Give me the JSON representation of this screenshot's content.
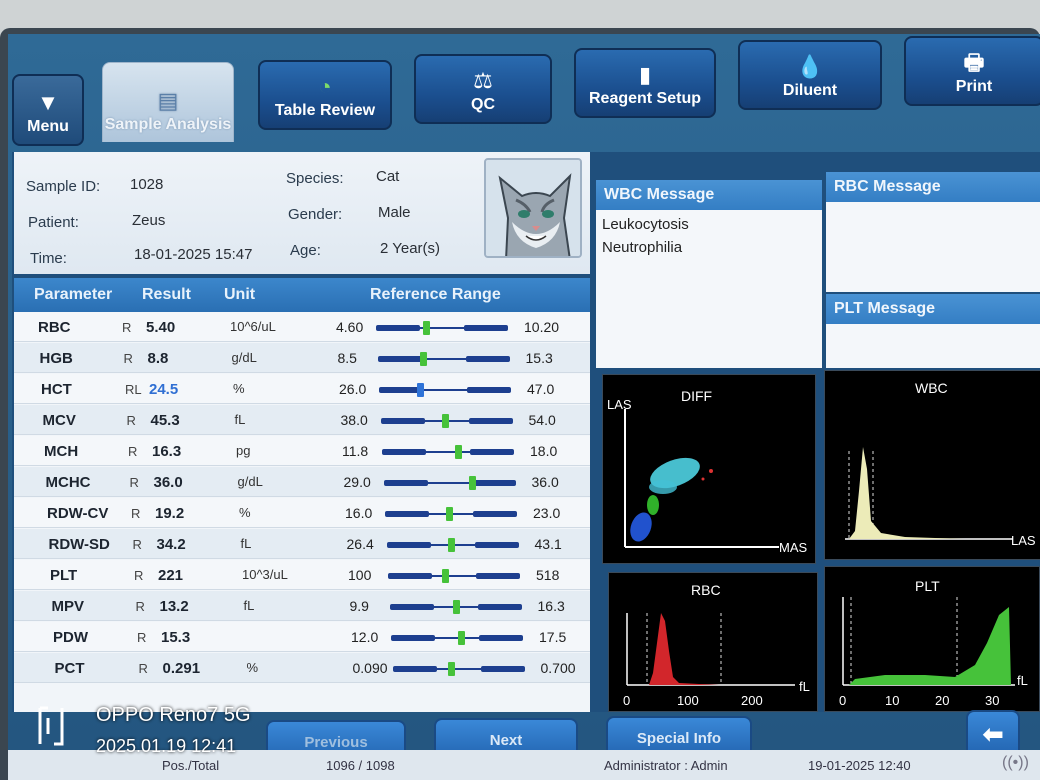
{
  "toolbar": {
    "menu": "Menu",
    "sample_analysis": "Sample Analysis",
    "table_review": "Table Review",
    "qc": "QC",
    "reagent_setup": "Reagent Setup",
    "diluent": "Diluent",
    "print": "Print"
  },
  "sample": {
    "sample_id_label": "Sample ID:",
    "sample_id": "1028",
    "patient_label": "Patient:",
    "patient": "Zeus",
    "time_label": "Time:",
    "time": "18-01-2025 15:47",
    "species_label": "Species:",
    "species": "Cat",
    "gender_label": "Gender:",
    "gender": "Male",
    "age_label": "Age:",
    "age": "2 Year(s)"
  },
  "table": {
    "headers": {
      "parameter": "Parameter",
      "result": "Result",
      "unit": "Unit",
      "reference": "Reference Range"
    },
    "rows": [
      {
        "name": "RBC",
        "flag": "R",
        "result": "5.40",
        "unit": "10^6/uL",
        "lo": "4.60",
        "hi": "10.20",
        "pos": 0.14
      },
      {
        "name": "HGB",
        "flag": "R",
        "result": "8.8",
        "unit": "g/dL",
        "lo": "8.5",
        "hi": "15.3",
        "pos": 0.04
      },
      {
        "name": "HCT",
        "flag": "RL",
        "result": "24.5",
        "unit": "%",
        "lo": "26.0",
        "hi": "47.0",
        "pos": -0.07
      },
      {
        "name": "MCV",
        "flag": "R",
        "result": "45.3",
        "unit": "fL",
        "lo": "38.0",
        "hi": "54.0",
        "pos": 0.46
      },
      {
        "name": "MCH",
        "flag": "R",
        "result": "16.3",
        "unit": "pg",
        "lo": "11.8",
        "hi": "18.0",
        "pos": 0.73
      },
      {
        "name": "MCHC",
        "flag": "R",
        "result": "36.0",
        "unit": "g/dL",
        "lo": "29.0",
        "hi": "36.0",
        "pos": 1.0
      },
      {
        "name": "RDW-CV",
        "flag": "R",
        "result": "19.2",
        "unit": "%",
        "lo": "16.0",
        "hi": "23.0",
        "pos": 0.46
      },
      {
        "name": "RDW-SD",
        "flag": "R",
        "result": "34.2",
        "unit": "fL",
        "lo": "26.4",
        "hi": "43.1",
        "pos": 0.47
      },
      {
        "name": "PLT",
        "flag": "R",
        "result": "221",
        "unit": "10^3/uL",
        "lo": "100",
        "hi": "518",
        "pos": 0.29
      },
      {
        "name": "MPV",
        "flag": "R",
        "result": "13.2",
        "unit": "fL",
        "lo": "9.9",
        "hi": "16.3",
        "pos": 0.52
      },
      {
        "name": "PDW",
        "flag": "R",
        "result": "15.3",
        "unit": "",
        "lo": "12.0",
        "hi": "17.5",
        "pos": 0.6
      },
      {
        "name": "PCT",
        "flag": "R",
        "result": "0.291",
        "unit": "%",
        "lo": "0.090",
        "hi": "0.700",
        "pos": 0.33
      }
    ]
  },
  "messages": {
    "wbc_title": "WBC Message",
    "wbc_lines": [
      "Leukocytosis",
      "Neutrophilia"
    ],
    "rbc_title": "RBC Message",
    "plt_title": "PLT Message"
  },
  "graphs": {
    "diff_title": "DIFF",
    "diff_y": "LAS",
    "diff_x": "MAS",
    "wbc_title": "WBC",
    "wbc_x": "LAS",
    "rbc_title": "RBC",
    "rbc_unit": "fL",
    "rbc_ticks": [
      "0",
      "100",
      "200"
    ],
    "plt_title": "PLT",
    "plt_unit": "fL",
    "plt_ticks": [
      "0",
      "10",
      "20",
      "30"
    ]
  },
  "bottom": {
    "previous": "Previous",
    "next": "Next",
    "special_info": "Special Info",
    "pos_total_label": "Pos./Total",
    "pos_total": "1096 / 1098",
    "user": "Administrator : Admin",
    "datetime": "19-01-2025 12:40"
  },
  "watermark": {
    "device": "OPPO Reno7 5G",
    "timestamp": "2025.01.19 12:41"
  },
  "colors": {
    "normal_marker": "#46c23a",
    "low_marker": "#2e73d8",
    "header_blue": "#2a6fb3"
  }
}
